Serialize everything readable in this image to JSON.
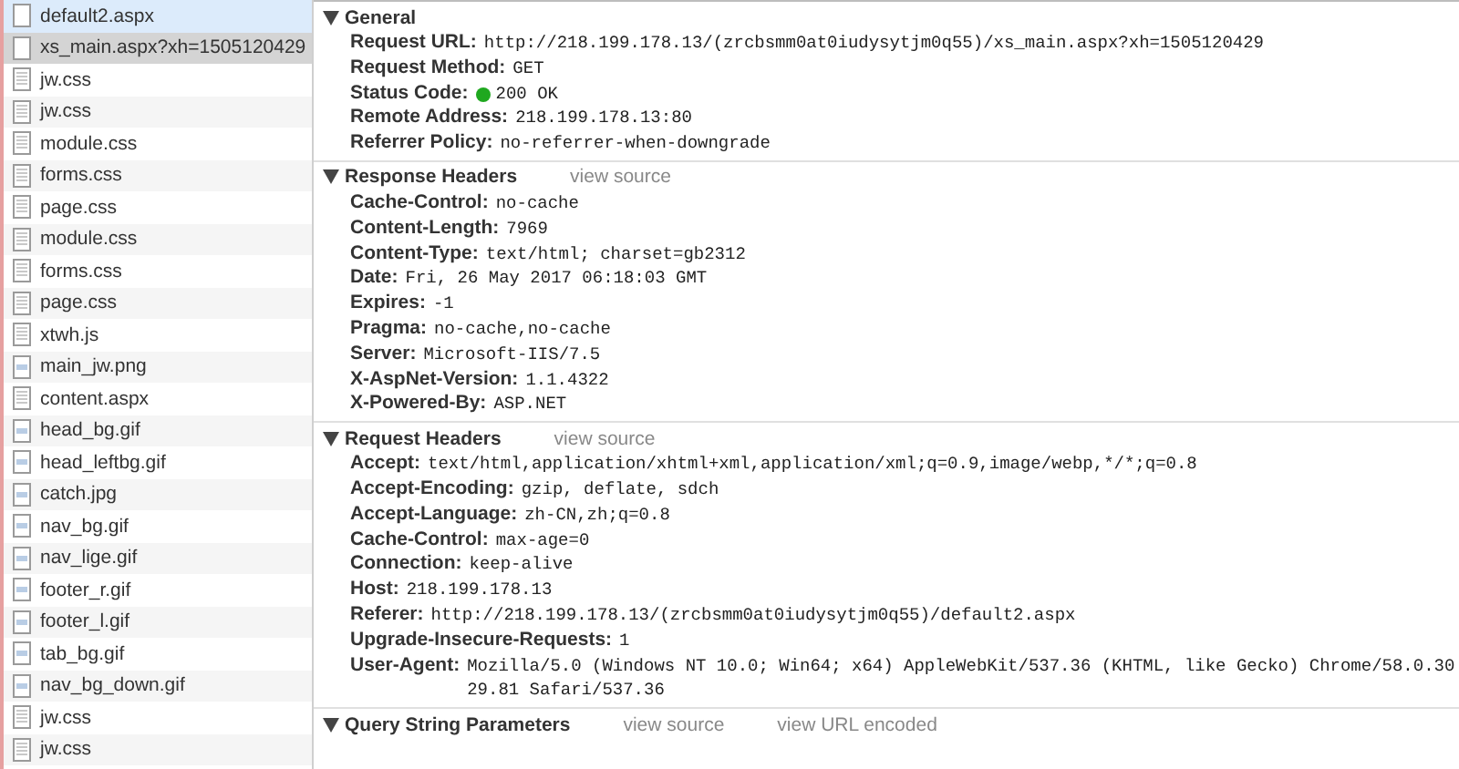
{
  "files": [
    {
      "name": "default2.aspx",
      "kind": "document",
      "selected": false,
      "hovered": true
    },
    {
      "name": "xs_main.aspx?xh=1505120429",
      "kind": "document",
      "selected": true,
      "hovered": false
    },
    {
      "name": "jw.css",
      "kind": "stylesheet",
      "selected": false,
      "hovered": false
    },
    {
      "name": "jw.css",
      "kind": "stylesheet",
      "selected": false,
      "hovered": false
    },
    {
      "name": "module.css",
      "kind": "stylesheet",
      "selected": false,
      "hovered": false
    },
    {
      "name": "forms.css",
      "kind": "stylesheet",
      "selected": false,
      "hovered": false
    },
    {
      "name": "page.css",
      "kind": "stylesheet",
      "selected": false,
      "hovered": false
    },
    {
      "name": "module.css",
      "kind": "stylesheet",
      "selected": false,
      "hovered": false
    },
    {
      "name": "forms.css",
      "kind": "stylesheet",
      "selected": false,
      "hovered": false
    },
    {
      "name": "page.css",
      "kind": "stylesheet",
      "selected": false,
      "hovered": false
    },
    {
      "name": "xtwh.js",
      "kind": "stylesheet",
      "selected": false,
      "hovered": false
    },
    {
      "name": "main_jw.png",
      "kind": "image",
      "selected": false,
      "hovered": false
    },
    {
      "name": "content.aspx",
      "kind": "stylesheet",
      "selected": false,
      "hovered": false
    },
    {
      "name": "head_bg.gif",
      "kind": "image",
      "selected": false,
      "hovered": false
    },
    {
      "name": "head_leftbg.gif",
      "kind": "image",
      "selected": false,
      "hovered": false
    },
    {
      "name": "catch.jpg",
      "kind": "image",
      "selected": false,
      "hovered": false
    },
    {
      "name": "nav_bg.gif",
      "kind": "image",
      "selected": false,
      "hovered": false
    },
    {
      "name": "nav_lige.gif",
      "kind": "image",
      "selected": false,
      "hovered": false
    },
    {
      "name": "footer_r.gif",
      "kind": "image",
      "selected": false,
      "hovered": false
    },
    {
      "name": "footer_l.gif",
      "kind": "image",
      "selected": false,
      "hovered": false
    },
    {
      "name": "tab_bg.gif",
      "kind": "image",
      "selected": false,
      "hovered": false
    },
    {
      "name": "nav_bg_down.gif",
      "kind": "image",
      "selected": false,
      "hovered": false
    },
    {
      "name": "jw.css",
      "kind": "stylesheet",
      "selected": false,
      "hovered": false
    },
    {
      "name": "jw.css",
      "kind": "stylesheet",
      "selected": false,
      "hovered": false
    }
  ],
  "sections": [
    {
      "title": "General",
      "expanded": true,
      "rows": [
        {
          "name": "Request URL:",
          "value": "http://218.199.178.13/(zrcbsmm0at0iudysytjm0q55)/xs_main.aspx?xh=1505120429",
          "kind": "plain"
        },
        {
          "name": "Request Method:",
          "value": "GET",
          "kind": "plain"
        },
        {
          "name": "Status Code:",
          "value": "200 OK",
          "kind": "status"
        },
        {
          "name": "Remote Address:",
          "value": "218.199.178.13:80",
          "kind": "plain"
        },
        {
          "name": "Referrer Policy:",
          "value": "no-referrer-when-downgrade",
          "kind": "plain"
        }
      ]
    },
    {
      "title": "Response Headers",
      "expanded": true,
      "links": [
        "view source"
      ],
      "rows": [
        {
          "name": "Cache-Control:",
          "value": "no-cache",
          "kind": "plain"
        },
        {
          "name": "Content-Length:",
          "value": "7969",
          "kind": "plain"
        },
        {
          "name": "Content-Type:",
          "value": "text/html; charset=gb2312",
          "kind": "plain"
        },
        {
          "name": "Date:",
          "value": "Fri, 26 May 2017 06:18:03 GMT",
          "kind": "plain"
        },
        {
          "name": "Expires:",
          "value": "-1",
          "kind": "plain"
        },
        {
          "name": "Pragma:",
          "value": "no-cache,no-cache",
          "kind": "plain"
        },
        {
          "name": "Server:",
          "value": "Microsoft-IIS/7.5",
          "kind": "plain"
        },
        {
          "name": "X-AspNet-Version:",
          "value": "1.1.4322",
          "kind": "plain"
        },
        {
          "name": "X-Powered-By:",
          "value": "ASP.NET",
          "kind": "plain"
        }
      ]
    },
    {
      "title": "Request Headers",
      "expanded": true,
      "links": [
        "view source"
      ],
      "rows": [
        {
          "name": "Accept:",
          "value": "text/html,application/xhtml+xml,application/xml;q=0.9,image/webp,*/*;q=0.8",
          "kind": "plain"
        },
        {
          "name": "Accept-Encoding:",
          "value": "gzip, deflate, sdch",
          "kind": "plain"
        },
        {
          "name": "Accept-Language:",
          "value": "zh-CN,zh;q=0.8",
          "kind": "plain"
        },
        {
          "name": "Cache-Control:",
          "value": "max-age=0",
          "kind": "plain"
        },
        {
          "name": "Connection:",
          "value": "keep-alive",
          "kind": "plain"
        },
        {
          "name": "Host:",
          "value": "218.199.178.13",
          "kind": "plain"
        },
        {
          "name": "Referer:",
          "value": "http://218.199.178.13/(zrcbsmm0at0iudysytjm0q55)/default2.aspx",
          "kind": "plain"
        },
        {
          "name": "Upgrade-Insecure-Requests:",
          "value": "1",
          "kind": "plain"
        },
        {
          "name": "User-Agent:",
          "value": "Mozilla/5.0 (Windows NT 10.0; Win64; x64) AppleWebKit/537.36 (KHTML, like Gecko) Chrome/58.0.3029.81 Safari/537.36",
          "kind": "plain"
        }
      ]
    },
    {
      "title": "Query String Parameters",
      "expanded": true,
      "links": [
        "view source",
        "view URL encoded"
      ]
    }
  ]
}
